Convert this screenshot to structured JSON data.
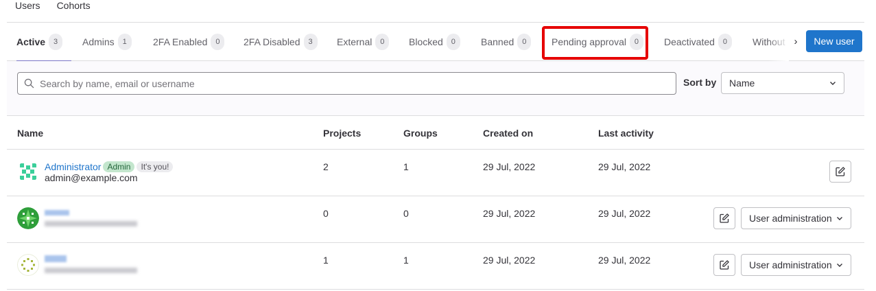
{
  "top_tabs": [
    {
      "label": "Users",
      "active": true
    },
    {
      "label": "Cohorts",
      "active": false
    }
  ],
  "filter_tabs": [
    {
      "label": "Active",
      "count": "3",
      "active": true
    },
    {
      "label": "Admins",
      "count": "1"
    },
    {
      "label": "2FA Enabled",
      "count": "0"
    },
    {
      "label": "2FA Disabled",
      "count": "3"
    },
    {
      "label": "External",
      "count": "0"
    },
    {
      "label": "Blocked",
      "count": "0"
    },
    {
      "label": "Banned",
      "count": "0"
    },
    {
      "label": "Pending approval",
      "count": "0",
      "highlighted": true
    },
    {
      "label": "Deactivated",
      "count": "0"
    },
    {
      "label": "Without",
      "count": ""
    }
  ],
  "new_user_label": "New user",
  "search": {
    "placeholder": "Search by name, email or username",
    "value": ""
  },
  "sort": {
    "label": "Sort by",
    "selected": "Name"
  },
  "table": {
    "headers": {
      "name": "Name",
      "projects": "Projects",
      "groups": "Groups",
      "created": "Created on",
      "activity": "Last activity"
    },
    "rows": [
      {
        "name": "Administrator",
        "admin_badge": "Admin",
        "you_badge": "It's you!",
        "email": "admin@example.com",
        "projects": "2",
        "groups": "1",
        "created": "29 Jul, 2022",
        "activity": "29 Jul, 2022"
      },
      {
        "projects": "0",
        "groups": "0",
        "created": "29 Jul, 2022",
        "activity": "29 Jul, 2022",
        "action_label": "User administration"
      },
      {
        "projects": "1",
        "groups": "1",
        "created": "29 Jul, 2022",
        "activity": "29 Jul, 2022",
        "action_label": "User administration"
      }
    ]
  },
  "colors": {
    "accent": "#1f75cb",
    "active_tab_underline": "#7b76c6",
    "highlight": "#e60000"
  }
}
